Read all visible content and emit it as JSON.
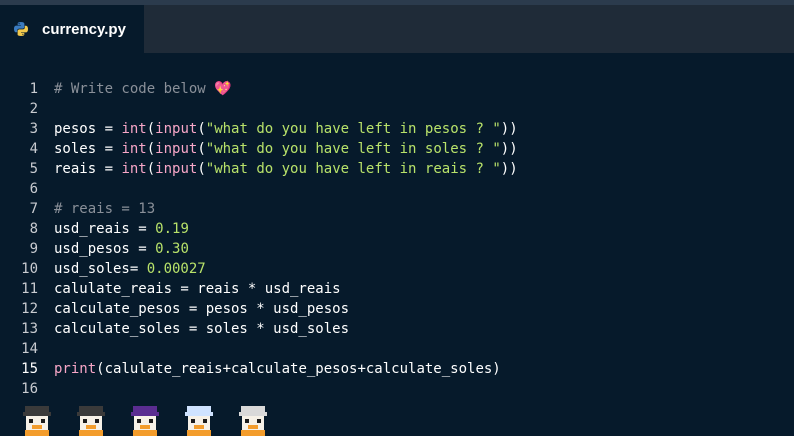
{
  "tab": {
    "filename": "currency.py",
    "icon": "python-icon"
  },
  "editor": {
    "active_line": 15,
    "lines": [
      {
        "n": "1",
        "tokens": [
          {
            "t": "# Write code below ",
            "c": "comment"
          },
          {
            "t": "💖",
            "c": "heart"
          }
        ]
      },
      {
        "n": "2",
        "tokens": []
      },
      {
        "n": "3",
        "tokens": [
          {
            "t": "pesos = ",
            "c": "plain"
          },
          {
            "t": "int",
            "c": "builtin"
          },
          {
            "t": "(",
            "c": "plain"
          },
          {
            "t": "input",
            "c": "builtin"
          },
          {
            "t": "(",
            "c": "plain"
          },
          {
            "t": "\"what do you have left in pesos ? \"",
            "c": "string"
          },
          {
            "t": "))",
            "c": "plain"
          }
        ]
      },
      {
        "n": "4",
        "tokens": [
          {
            "t": "soles = ",
            "c": "plain"
          },
          {
            "t": "int",
            "c": "builtin"
          },
          {
            "t": "(",
            "c": "plain"
          },
          {
            "t": "input",
            "c": "builtin"
          },
          {
            "t": "(",
            "c": "plain"
          },
          {
            "t": "\"what do you have left in soles ? \"",
            "c": "string"
          },
          {
            "t": "))",
            "c": "plain"
          }
        ]
      },
      {
        "n": "5",
        "tokens": [
          {
            "t": "reais = ",
            "c": "plain"
          },
          {
            "t": "int",
            "c": "builtin"
          },
          {
            "t": "(",
            "c": "plain"
          },
          {
            "t": "input",
            "c": "builtin"
          },
          {
            "t": "(",
            "c": "plain"
          },
          {
            "t": "\"what do you have left in reais ? \"",
            "c": "string"
          },
          {
            "t": "))",
            "c": "plain"
          }
        ]
      },
      {
        "n": "6",
        "tokens": []
      },
      {
        "n": "7",
        "tokens": [
          {
            "t": "# reais = 13",
            "c": "comment"
          }
        ]
      },
      {
        "n": "8",
        "tokens": [
          {
            "t": "usd_reais = ",
            "c": "plain"
          },
          {
            "t": "0.19",
            "c": "number"
          }
        ]
      },
      {
        "n": "9",
        "tokens": [
          {
            "t": "usd_pesos = ",
            "c": "plain"
          },
          {
            "t": "0.30",
            "c": "number"
          }
        ]
      },
      {
        "n": "10",
        "tokens": [
          {
            "t": "usd_soles= ",
            "c": "plain"
          },
          {
            "t": "0.00027",
            "c": "number"
          }
        ]
      },
      {
        "n": "11",
        "tokens": [
          {
            "t": "calulate_reais = reais * usd_reais",
            "c": "plain"
          }
        ]
      },
      {
        "n": "12",
        "tokens": [
          {
            "t": "calculate_pesos = pesos * usd_pesos",
            "c": "plain"
          }
        ]
      },
      {
        "n": "13",
        "tokens": [
          {
            "t": "calculate_soles = soles * usd_soles",
            "c": "plain"
          }
        ]
      },
      {
        "n": "14",
        "tokens": []
      },
      {
        "n": "15",
        "tokens": [
          {
            "t": "print",
            "c": "builtin"
          },
          {
            "t": "(calulate_reais+calculate_pesos+calculate_soles)",
            "c": "plain"
          }
        ]
      },
      {
        "n": "16",
        "tokens": []
      }
    ]
  },
  "avatars": [
    {
      "name": "avatar-1",
      "hat": "#3a3a3a"
    },
    {
      "name": "avatar-2",
      "hat": "#3a3a3a"
    },
    {
      "name": "avatar-3",
      "hat": "#5a2d91"
    },
    {
      "name": "avatar-4",
      "hat": "#cfe3ff"
    },
    {
      "name": "avatar-5",
      "hat": "#d9d9d9"
    }
  ]
}
